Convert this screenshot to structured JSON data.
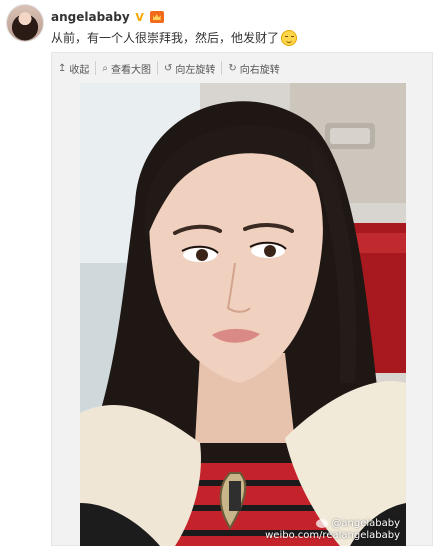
{
  "post": {
    "username": "angelababy",
    "verified_badge": "V",
    "text": "从前，有一个人很崇拜我，然后，他发财了",
    "emoji": "smile-emoji"
  },
  "toolbar": {
    "items": [
      {
        "icon": "↥",
        "label": "收起"
      },
      {
        "icon": "⌕",
        "label": "查看大图"
      },
      {
        "icon": "↺",
        "label": "向左旋转"
      },
      {
        "icon": "↻",
        "label": "向右旋转"
      }
    ]
  },
  "image": {
    "description_icon": "photo",
    "watermark_line1": "@angelababy",
    "watermark_line2": "weibo.com/realangelababy"
  }
}
